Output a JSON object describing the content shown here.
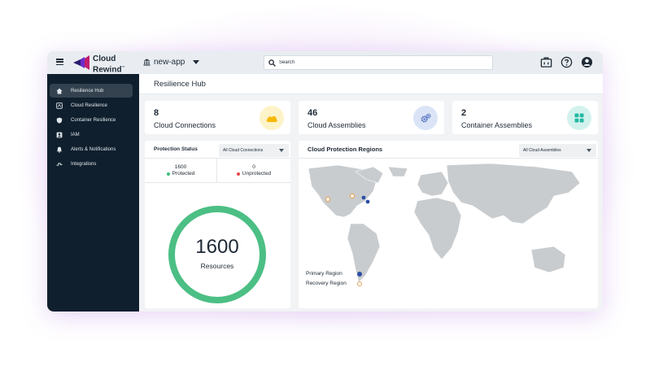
{
  "app": {
    "brand_line1": "Cloud",
    "brand_line2": "Rewind",
    "brand_tm": "™",
    "app_name": "new-app",
    "search_placeholder": "Search"
  },
  "colors": {
    "sidebar_bg": "#0f1f2d",
    "accent_green": "#4cbf84",
    "primary_region": "#2c4fa3",
    "recovery_region": "#e3a257",
    "protected": "#3fbf7f",
    "unprotected": "#e24a4a"
  },
  "sidebar": {
    "items": [
      {
        "label": "Resilience Hub",
        "icon": "home-icon"
      },
      {
        "label": "Cloud Resilience",
        "icon": "cloud-resilience-icon"
      },
      {
        "label": "Container Resilience",
        "icon": "shield-icon"
      },
      {
        "label": "IAM",
        "icon": "user-badge-icon"
      },
      {
        "label": "Alerts & Notifications",
        "icon": "bell-icon"
      },
      {
        "label": "Integrations",
        "icon": "integrations-icon"
      }
    ]
  },
  "topbar_icons": [
    "briefcase-icon",
    "help-icon",
    "account-icon"
  ],
  "page": {
    "title": "Resilience Hub"
  },
  "stats": [
    {
      "value": "8",
      "label": "Cloud Connections",
      "icon": "cloud-icon"
    },
    {
      "value": "46",
      "label": "Cloud Assemblies",
      "icon": "gears-icon"
    },
    {
      "value": "2",
      "label": "Container Assemblies",
      "icon": "grid-icon"
    }
  ],
  "protection": {
    "title": "Protection Status",
    "filter": "All Cloud Connections",
    "protected_value": "1600",
    "protected_label": "Protected",
    "unprotected_value": "0",
    "unprotected_label": "Unprotected",
    "ring_value": "1600",
    "ring_label": "Resources",
    "protected_fraction": 1.0
  },
  "regions": {
    "title": "Cloud Protection Regions",
    "filter": "All Cloud Assemblies",
    "legend_primary": "Primary Region",
    "legend_recovery": "Recovery Region"
  }
}
